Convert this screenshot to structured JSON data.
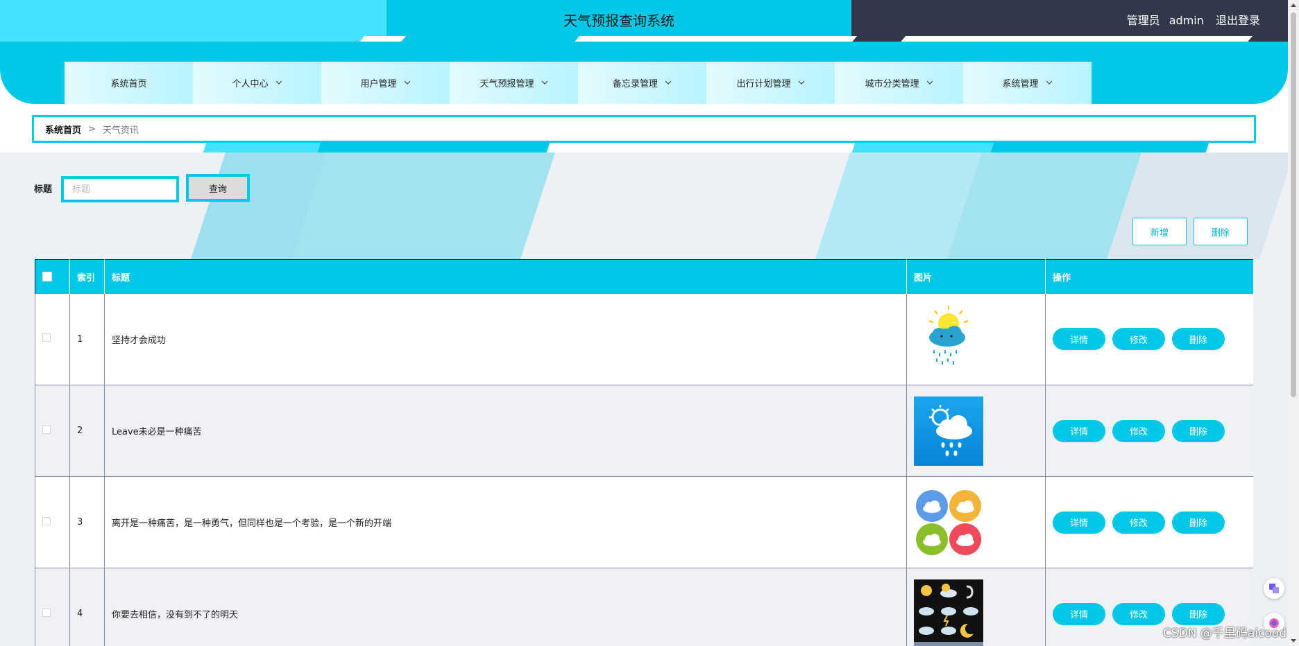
{
  "header": {
    "title": "天气预报查询系统",
    "user_role": "管理员",
    "user_name": "admin",
    "logout_label": "退出登录"
  },
  "nav": {
    "items": [
      {
        "label": "系统首页",
        "has_dropdown": false
      },
      {
        "label": "个人中心",
        "has_dropdown": true
      },
      {
        "label": "用户管理",
        "has_dropdown": true
      },
      {
        "label": "天气预报管理",
        "has_dropdown": true
      },
      {
        "label": "备忘录管理",
        "has_dropdown": true
      },
      {
        "label": "出行计划管理",
        "has_dropdown": true
      },
      {
        "label": "城市分类管理",
        "has_dropdown": true
      },
      {
        "label": "系统管理",
        "has_dropdown": true
      }
    ],
    "chevron": "⌄"
  },
  "breadcrumb": {
    "home": "系统首页",
    "separator": ">",
    "current": "天气资讯"
  },
  "search": {
    "label": "标题",
    "placeholder": "标题",
    "value": "",
    "button_label": "查询"
  },
  "toolbar": {
    "add_label": "新增",
    "delete_label": "删除"
  },
  "table": {
    "columns": [
      "索引",
      "标题",
      "图片",
      "操作"
    ],
    "rows": [
      {
        "index": "1",
        "title": "坚持才会成功",
        "image": "sun-cloud-rain-icon"
      },
      {
        "index": "2",
        "title": "Leave未必是一种痛苦",
        "image": "blue-rain-tile-icon"
      },
      {
        "index": "3",
        "title": "离开是一种痛苦，是一种勇气，但同样也是一个考验，是一个新的开端",
        "image": "four-circle-clouds-icon"
      },
      {
        "index": "4",
        "title": "你要去相信，没有到不了的明天",
        "image": "weather-icon-set-icon"
      }
    ],
    "row_actions": {
      "detail": "详情",
      "edit": "修改",
      "delete": "删除"
    }
  },
  "watermark": "CSDN @千里码aicood",
  "colors": {
    "accent": "#00c8e6",
    "accent_light": "#44e2ff",
    "dark": "#31384a",
    "main_bg": "#edf0f5"
  }
}
